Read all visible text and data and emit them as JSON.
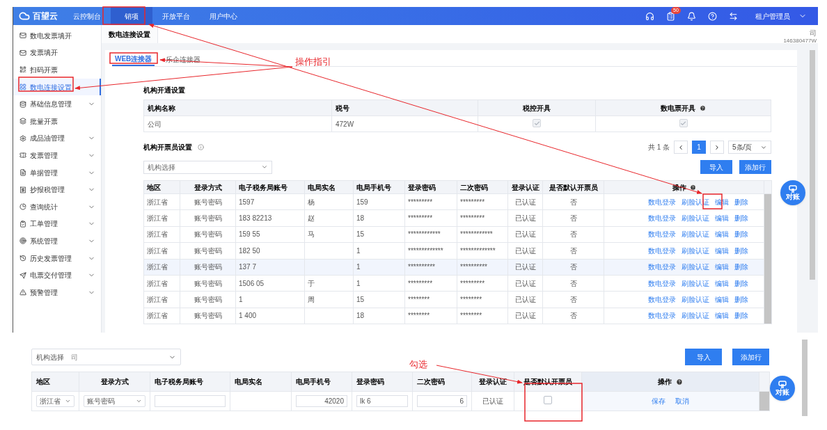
{
  "top_nav": {
    "logo": "百望云",
    "items": [
      {
        "label": "云控制台",
        "selected": false
      },
      {
        "label": "销项",
        "selected": true
      },
      {
        "label": "开放平台",
        "selected": false
      },
      {
        "label": "用户中心",
        "selected": false
      }
    ],
    "badge": "50",
    "user": "租户管理员"
  },
  "sidebar": {
    "items": [
      {
        "label": "数电发票填开",
        "selected": false,
        "expandable": false
      },
      {
        "label": "发票填开",
        "selected": false,
        "expandable": false
      },
      {
        "label": "扫码开票",
        "selected": false,
        "expandable": false
      },
      {
        "label": "数电连接设置",
        "selected": true,
        "expandable": false
      },
      {
        "label": "基础信息管理",
        "selected": false,
        "expandable": true
      },
      {
        "label": "批量开票",
        "selected": false,
        "expandable": false
      },
      {
        "label": "成品油管理",
        "selected": false,
        "expandable": true
      },
      {
        "label": "发票管理",
        "selected": false,
        "expandable": true
      },
      {
        "label": "单据管理",
        "selected": false,
        "expandable": true
      },
      {
        "label": "抄报税管理",
        "selected": false,
        "expandable": true
      },
      {
        "label": "查询统计",
        "selected": false,
        "expandable": true
      },
      {
        "label": "工单管理",
        "selected": false,
        "expandable": true
      },
      {
        "label": "系统管理",
        "selected": false,
        "expandable": true
      },
      {
        "label": "历史发票管理",
        "selected": false,
        "expandable": true
      },
      {
        "label": "电票交付管理",
        "selected": false,
        "expandable": true
      },
      {
        "label": "预警管理",
        "selected": false,
        "expandable": true
      }
    ]
  },
  "page_tab": {
    "label": "数电连接设置"
  },
  "org_info": {
    "line_1": "司",
    "line_2": "146380477W"
  },
  "connector_tabs": [
    {
      "label": "WEB连接器",
      "selected": true
    },
    {
      "label": "乐企连接器",
      "selected": false
    }
  ],
  "org_section": {
    "title": "机构开通设置",
    "columns": [
      "机构名称",
      "税号",
      "税控开具",
      "数电票开具"
    ],
    "rows": [
      {
        "name": "公司",
        "tax_id": "472W",
        "tax_control_checked": true,
        "digital_checked": true
      }
    ]
  },
  "invoicer_section": {
    "title": "机构开票员设置",
    "org_select": {
      "label": "机构选择"
    },
    "pagination": {
      "total": "共 1 条",
      "page": "1",
      "page_size": "5条/页"
    },
    "buttons": [
      "导入",
      "添加行"
    ],
    "columns": [
      "地区",
      "登录方式",
      "电子税务局账号",
      "电局实名",
      "电局手机号",
      "登录密码",
      "二次密码",
      "登录认证",
      "是否默认开票员",
      "操作"
    ],
    "rows": [
      {
        "highlighted": false,
        "cells": [
          "浙江省",
          "账号密码",
          "1597",
          "杨",
          "159",
          "*********",
          "*********",
          "已认证",
          "否"
        ],
        "actions": [
          "数电登录",
          "刷脸认证",
          "编辑",
          "删除"
        ]
      },
      {
        "highlighted": false,
        "cells": [
          "浙江省",
          "账号密码",
          "183 82213",
          "赵",
          "18",
          "*********",
          "*********",
          "已认证",
          "否"
        ],
        "actions": [
          "数电登录",
          "刷脸认证",
          "编辑",
          "删除"
        ]
      },
      {
        "highlighted": false,
        "cells": [
          "浙江省",
          "账号密码",
          "159 55",
          "马",
          "15",
          "************",
          "************",
          "已认证",
          "否"
        ],
        "actions": [
          "数电登录",
          "刷脸认证",
          "编辑",
          "删除"
        ]
      },
      {
        "highlighted": false,
        "cells": [
          "浙江省",
          "账号密码",
          "182 50",
          "",
          "1",
          "*************",
          "*************",
          "已认证",
          "否"
        ],
        "actions": [
          "数电登录",
          "刷脸认证",
          "编辑",
          "删除"
        ]
      },
      {
        "highlighted": true,
        "cells": [
          "浙江省",
          "账号密码",
          "137 7",
          "",
          "1",
          "**********",
          "**********",
          "已认证",
          "否"
        ],
        "actions": [
          "数电登录",
          "刷脸认证",
          "编辑",
          "删除"
        ]
      },
      {
        "highlighted": false,
        "cells": [
          "浙江省",
          "账号密码",
          "1506 05",
          "于",
          "1",
          "*********",
          "*********",
          "已认证",
          "否"
        ],
        "actions": [
          "数电登录",
          "刷脸认证",
          "编辑",
          "删除"
        ]
      },
      {
        "highlighted": false,
        "cells": [
          "浙江省",
          "账号密码",
          "1",
          "周",
          "15",
          "********",
          "********",
          "已认证",
          "否"
        ],
        "actions": [
          "数电登录",
          "刷脸认证",
          "编辑",
          "删除"
        ]
      },
      {
        "highlighted": false,
        "cells": [
          "浙江省",
          "账号密码",
          "1 400",
          "",
          "18",
          "********",
          "********",
          "已认证",
          "否"
        ],
        "actions": [
          "数电登录",
          "刷脸认证",
          "编辑",
          "删除"
        ]
      }
    ]
  },
  "edit_snippet": {
    "org_select": {
      "label": "机构选择",
      "value": "司"
    },
    "buttons": [
      "导入",
      "添加行"
    ],
    "columns": [
      "地区",
      "登录方式",
      "电子税务局账号",
      "电局实名",
      "电局手机号",
      "登录密码",
      "二次密码",
      "登录认证",
      "是否默认开票员",
      "操作"
    ],
    "row": {
      "region": "浙江省",
      "login_method": "账号密码",
      "phone": "42020",
      "password": "lk 6",
      "second_password": "6",
      "auth": "已认证",
      "default_checked": false,
      "actions": [
        "保存",
        "取消"
      ]
    }
  },
  "annotations": {
    "guide": "操作指引",
    "check": "勾选"
  },
  "float_buttons": [
    "对账",
    "对账"
  ]
}
